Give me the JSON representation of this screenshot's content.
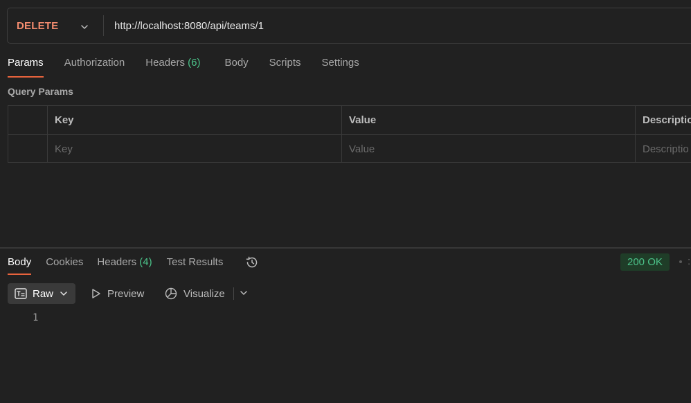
{
  "request": {
    "method": "DELETE",
    "url": "http://localhost:8080/api/teams/1",
    "method_color": "#f28b6e"
  },
  "request_tabs": [
    {
      "label": "Params",
      "count": ""
    },
    {
      "label": "Authorization",
      "count": ""
    },
    {
      "label": "Headers",
      "count": "(6)"
    },
    {
      "label": "Body",
      "count": ""
    },
    {
      "label": "Scripts",
      "count": ""
    },
    {
      "label": "Settings",
      "count": ""
    }
  ],
  "query_params": {
    "title": "Query Params",
    "headers": {
      "key": "Key",
      "value": "Value",
      "description": "Descriptio"
    },
    "placeholders": {
      "key": "Key",
      "value": "Value",
      "description": "Descriptio"
    }
  },
  "response": {
    "tabs": [
      {
        "label": "Body",
        "count": ""
      },
      {
        "label": "Cookies",
        "count": ""
      },
      {
        "label": "Headers",
        "count": "(4)"
      },
      {
        "label": "Test Results",
        "count": ""
      }
    ],
    "status": "200 OK",
    "status_color": "#4cc38a",
    "edge_fragment": ":",
    "view": {
      "raw": "Raw",
      "preview": "Preview",
      "visualize": "Visualize"
    },
    "line_numbers": [
      "1"
    ]
  },
  "icons": [
    "chevron-down-icon",
    "history-icon",
    "raw-format-icon",
    "play-icon",
    "visualize-icon"
  ],
  "accent_color": "#e8633d"
}
